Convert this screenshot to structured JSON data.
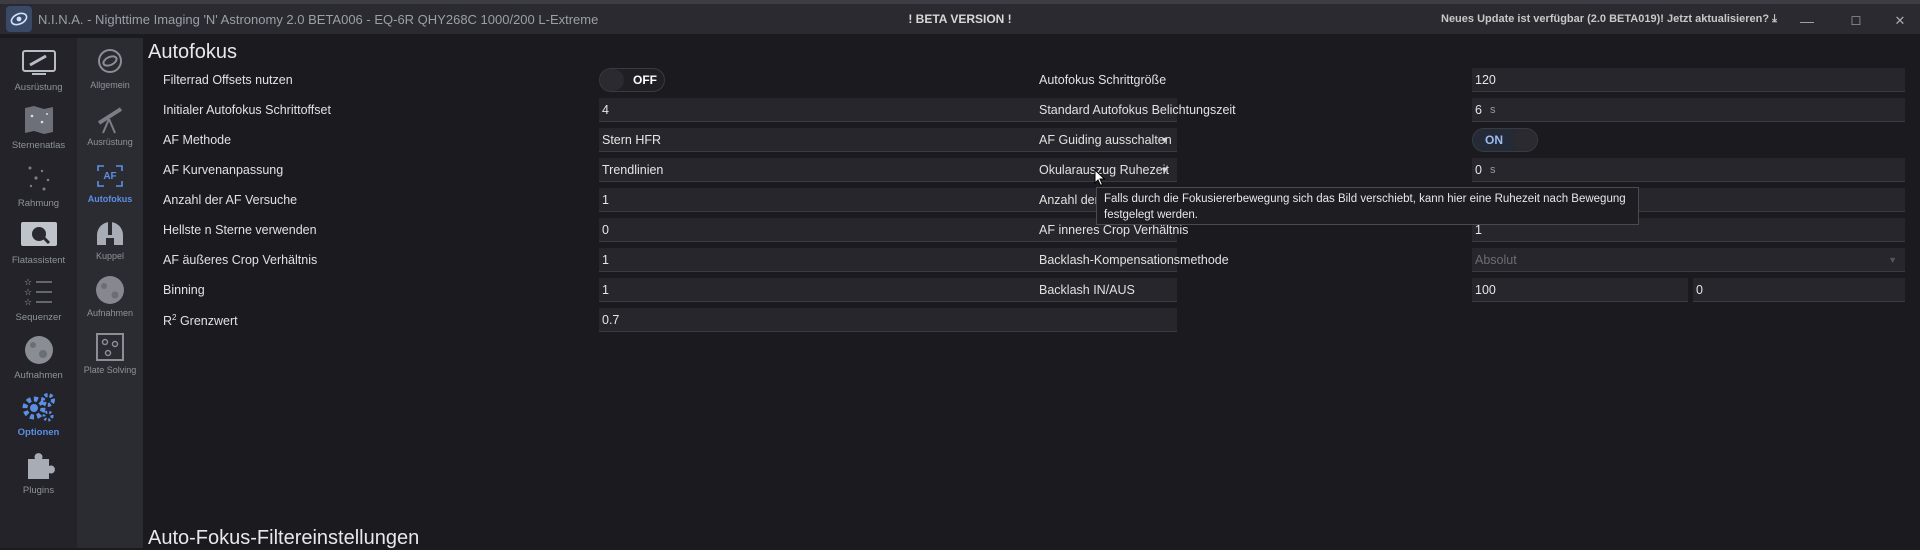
{
  "titlebar": {
    "title": "N.I.N.A. - Nighttime Imaging 'N' Astronomy 2.0 BETA006  -  EQ-6R QHY268C 1000/200 L-Extreme",
    "beta_label": "! BETA VERSION !",
    "update_notice": "Neues Update ist verfügbar (2.0 BETA019)! Jetzt aktualisieren?",
    "minimize": "—",
    "maximize": "☐",
    "close": "✕"
  },
  "nav": [
    {
      "label": "Ausrüstung",
      "icon": "telescope-icon"
    },
    {
      "label": "Sternenatlas",
      "icon": "star-map-icon"
    },
    {
      "label": "Rahmung",
      "icon": "framing-icon"
    },
    {
      "label": "Flatassistent",
      "icon": "flat-wizard-icon"
    },
    {
      "label": "Sequenzer",
      "icon": "sequencer-icon"
    },
    {
      "label": "Aufnahmen",
      "icon": "imaging-icon"
    },
    {
      "label": "Optionen",
      "icon": "gears-icon"
    },
    {
      "label": "Plugins",
      "icon": "puzzle-icon"
    }
  ],
  "subnav": [
    {
      "label": "Allgemein",
      "icon": "general-icon"
    },
    {
      "label": "Ausrüstung",
      "icon": "telescope-icon"
    },
    {
      "label": "Autofokus",
      "icon": "autofocus-icon",
      "badge": "AF"
    },
    {
      "label": "Kuppel",
      "icon": "dome-icon"
    },
    {
      "label": "Aufnahmen",
      "icon": "imaging-icon"
    },
    {
      "label": "Plate Solving",
      "icon": "plate-solving-icon"
    }
  ],
  "main": {
    "heading": "Autofokus",
    "heading2": "Auto-Fokus-Filtereinstellungen",
    "left": {
      "filter_offsets": {
        "label": "Filterrad Offsets nutzen",
        "value": "OFF"
      },
      "initial_offset": {
        "label": "Initialer Autofokus Schrittoffset",
        "value": "4"
      },
      "method": {
        "label": "AF Methode",
        "value": "Stern HFR"
      },
      "curve_fit": {
        "label": "AF Kurvenanpassung",
        "value": "Trendlinien"
      },
      "attempts": {
        "label": "Anzahl der AF Versuche",
        "value": "1"
      },
      "brightest": {
        "label": "Hellste n Sterne verwenden",
        "value": "0"
      },
      "outer_crop": {
        "label": "AF äußeres Crop Verhältnis",
        "value": "1"
      },
      "binning": {
        "label": "Binning",
        "value": "1"
      },
      "r2": {
        "label_main": "R",
        "label_sup": "2",
        "label_rest": " Grenzwert",
        "value": "0.7"
      }
    },
    "right": {
      "step_size": {
        "label": "Autofokus Schrittgröße",
        "value": "120"
      },
      "exposure": {
        "label": "Standard Autofokus Belichtungszeit",
        "value": "6",
        "unit": "s"
      },
      "guiding_off": {
        "label": "AF Guiding ausschalten",
        "value": "ON"
      },
      "settle": {
        "label": "Okularauszug Ruhezeit",
        "value": "0",
        "unit": "s"
      },
      "count": {
        "label": "Anzahl der",
        "value": ""
      },
      "inner_crop": {
        "label": "AF inneres Crop Verhältnis",
        "value": "1"
      },
      "backlash_method": {
        "label": "Backlash-Kompensationsmethode",
        "value": "Absolut"
      },
      "backlash": {
        "label": "Backlash IN/AUS",
        "in": "100",
        "out": "0"
      }
    },
    "tooltip": "Falls durch die Fokusiererbewegung sich das Bild verschiebt, kann hier eine Ruhezeit nach Bewegung festgelegt werden."
  },
  "colors": {
    "accent": "#5b8fe6",
    "background": "#1b1b1f",
    "field": "#26262c"
  }
}
